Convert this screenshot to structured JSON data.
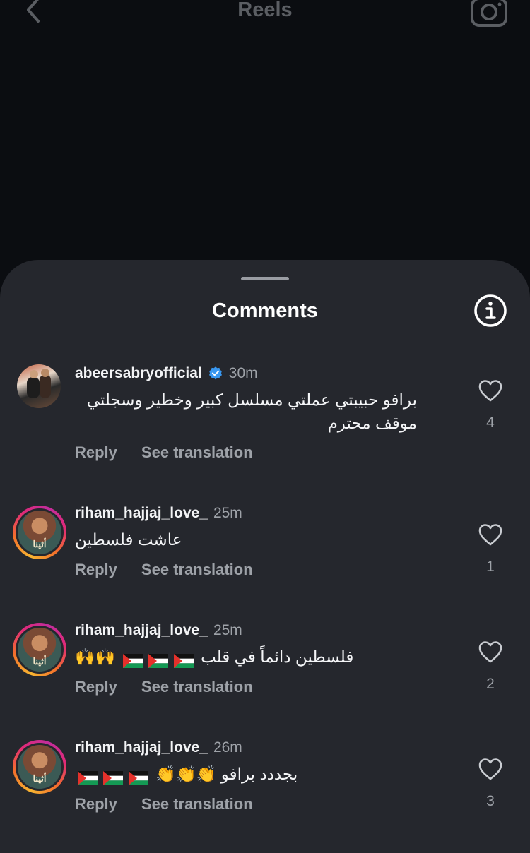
{
  "header": {
    "title": "Reels"
  },
  "sheet": {
    "title": "Comments"
  },
  "comments": [
    {
      "username": "abeersabryofficial",
      "verified": true,
      "time": "30m",
      "text_line1": "برافو حبيبتي عملتي مسلسل كبير وخطير وسجلتي",
      "text_line2": "موقف محترم",
      "reply": "Reply",
      "translate": "See translation",
      "likes": "4"
    },
    {
      "username": "riham_hajjaj_love_",
      "verified": false,
      "time": "25m",
      "text_line1": "عاشت فلسطين",
      "reply": "Reply",
      "translate": "See translation",
      "likes": "1",
      "avatar_caption": "أثينا"
    },
    {
      "username": "riham_hajjaj_love_",
      "verified": false,
      "time": "25m",
      "text_line1": "فلسطين دائماً في قلب",
      "emoji": "🙌🙌",
      "reply": "Reply",
      "translate": "See translation",
      "likes": "2",
      "avatar_caption": "أثينا"
    },
    {
      "username": "riham_hajjaj_love_",
      "verified": false,
      "time": "26m",
      "text_line1": "بجددد برافو",
      "emoji": "👏👏👏",
      "reply": "Reply",
      "translate": "See translation",
      "likes": "3",
      "avatar_caption": "أثينا"
    }
  ],
  "colors": {
    "verified_badge": "#3897f0",
    "sheet_bg": "#25272d",
    "muted_text": "#9ea2a8"
  }
}
